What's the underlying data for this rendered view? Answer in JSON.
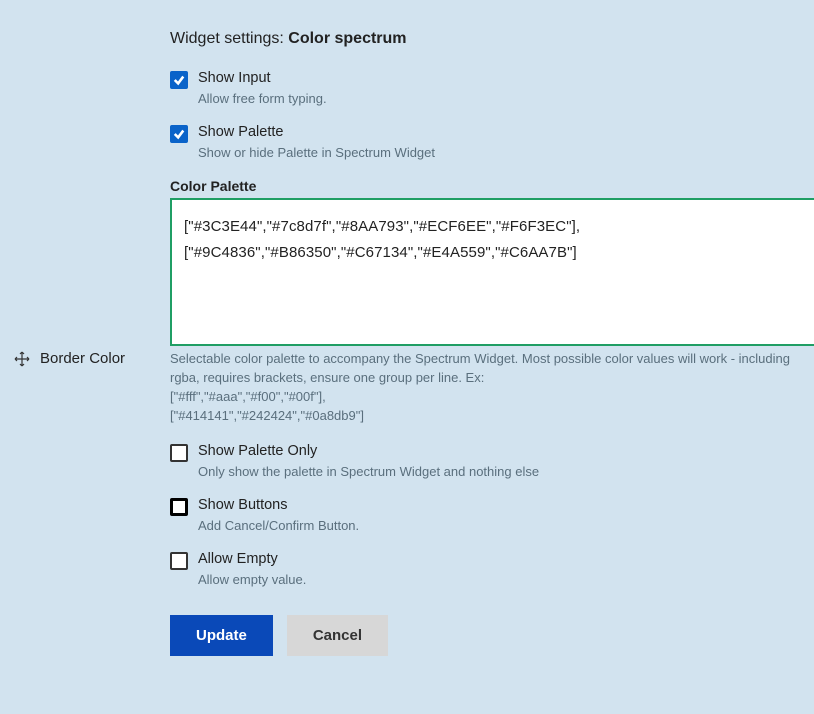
{
  "title": {
    "prefix": "Widget settings: ",
    "name": "Color spectrum"
  },
  "sideItem": {
    "label": "Border Color"
  },
  "fields": {
    "showInput": {
      "label": "Show Input",
      "help": "Allow free form typing.",
      "checked": true
    },
    "showPalette": {
      "label": "Show Palette",
      "help": "Show or hide Palette in Spectrum Widget",
      "checked": true
    },
    "colorPalette": {
      "label": "Color Palette",
      "value": "[\"#3C3E44\",\"#7c8d7f\",\"#8AA793\",\"#ECF6EE\",\"#F6F3EC\"],\n[\"#9C4836\",\"#B86350\",\"#C67134\",\"#E4A559\",\"#C6AA7B\"]",
      "help": "Selectable color palette to accompany the Spectrum Widget. Most possible color values will work - including rgba, requires brackets, ensure one group per line. Ex:",
      "example1": "[\"#fff\",\"#aaa\",\"#f00\",\"#00f\"],",
      "example2": "[\"#414141\",\"#242424\",\"#0a8db9\"]"
    },
    "showPaletteOnly": {
      "label": "Show Palette Only",
      "help": "Only show the palette in Spectrum Widget and nothing else",
      "checked": false
    },
    "showButtons": {
      "label": "Show Buttons",
      "help": "Add Cancel/Confirm Button.",
      "checked": false
    },
    "allowEmpty": {
      "label": "Allow Empty",
      "help": "Allow empty value.",
      "checked": false
    }
  },
  "buttons": {
    "update": "Update",
    "cancel": "Cancel"
  }
}
